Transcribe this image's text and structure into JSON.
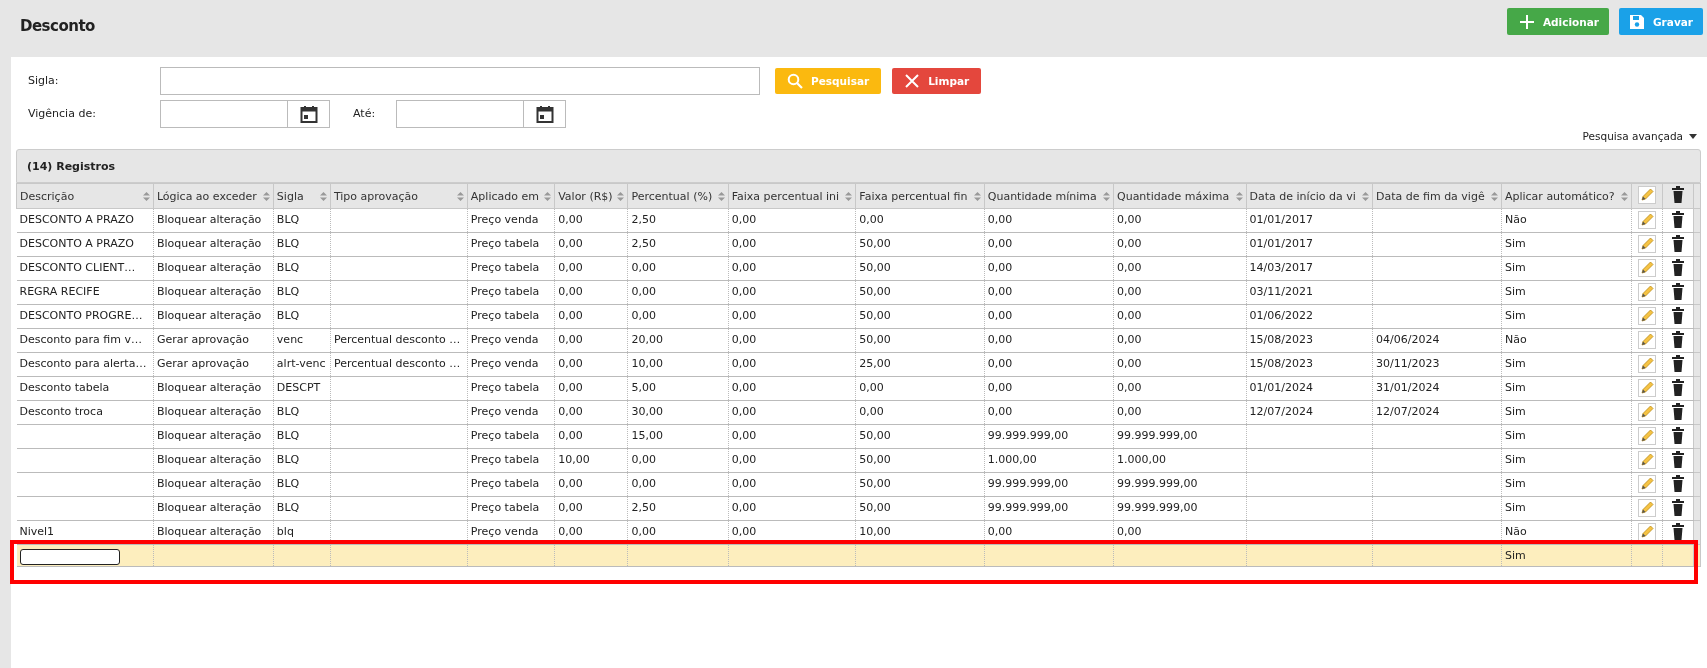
{
  "page": {
    "title": "Desconto"
  },
  "header_buttons": [
    {
      "label": "Adicionar",
      "kind": "add"
    },
    {
      "label": "Gravar",
      "kind": "save"
    }
  ],
  "filters": {
    "sigla_label": "Sigla:",
    "vigencia_label": "Vigência de:",
    "ate_label": "Até:",
    "search_button": "Pesquisar",
    "clear_button": "Limpar",
    "advanced_link": "Pesquisa avançada"
  },
  "panel": {
    "title": "(14) Registros"
  },
  "table": {
    "columns": [
      {
        "label": "Descrição",
        "sortable": true
      },
      {
        "label": "Lógica ao exceder",
        "sortable": true
      },
      {
        "label": "Sigla",
        "sortable": true
      },
      {
        "label": "Tipo aprovação",
        "sortable": true
      },
      {
        "label": "Aplicado em",
        "sortable": true
      },
      {
        "label": "Valor (R$)",
        "sortable": true
      },
      {
        "label": "Percentual (%)",
        "sortable": true
      },
      {
        "label": "Faixa percentual ini",
        "sortable": true
      },
      {
        "label": "Faixa percentual fin",
        "sortable": true
      },
      {
        "label": "Quantidade mínima",
        "sortable": true
      },
      {
        "label": "Quantidade máxima",
        "sortable": true
      },
      {
        "label": "Data de início da vi",
        "sortable": true
      },
      {
        "label": "Data de fim da vigê",
        "sortable": true
      },
      {
        "label": "Aplicar automático?",
        "sortable": true
      }
    ],
    "rows": [
      {
        "kind": "record",
        "cells": [
          "DESCONTO A PRAZO",
          "Bloquear alteração",
          "BLQ",
          null,
          "Preço venda",
          "0,00",
          "2,50",
          "0,00",
          "0,00",
          "0,00",
          "0,00",
          "01/01/2017",
          null,
          "Não"
        ]
      },
      {
        "kind": "record",
        "cells": [
          "DESCONTO A PRAZO",
          "Bloquear alteração",
          "BLQ",
          null,
          "Preço tabela",
          "0,00",
          "2,50",
          "0,00",
          "50,00",
          "0,00",
          "0,00",
          "01/01/2017",
          null,
          "Sim"
        ]
      },
      {
        "kind": "record",
        "cells": [
          "DESCONTO CLIENT…",
          "Bloquear alteração",
          "BLQ",
          null,
          "Preço tabela",
          "0,00",
          "0,00",
          "0,00",
          "50,00",
          "0,00",
          "0,00",
          "14/03/2017",
          null,
          "Sim"
        ]
      },
      {
        "kind": "record",
        "cells": [
          "REGRA RECIFE",
          "Bloquear alteração",
          "BLQ",
          null,
          "Preço tabela",
          "0,00",
          "0,00",
          "0,00",
          "50,00",
          "0,00",
          "0,00",
          "03/11/2021",
          null,
          "Sim"
        ]
      },
      {
        "kind": "record",
        "cells": [
          "DESCONTO PROGRE…",
          "Bloquear alteração",
          "BLQ",
          null,
          "Preço tabela",
          "0,00",
          "0,00",
          "0,00",
          "50,00",
          "0,00",
          "0,00",
          "01/06/2022",
          null,
          "Sim"
        ]
      },
      {
        "kind": "record",
        "cells": [
          "Desconto para fim v…",
          "Gerar aprovação",
          "venc",
          "Percentual desconto …",
          "Preço venda",
          "0,00",
          "20,00",
          "0,00",
          "50,00",
          "0,00",
          "0,00",
          "15/08/2023",
          "04/06/2024",
          "Não"
        ]
      },
      {
        "kind": "record",
        "cells": [
          "Desconto para alerta…",
          "Gerar aprovação",
          "alrt-venc",
          "Percentual desconto …",
          "Preço venda",
          "0,00",
          "10,00",
          "0,00",
          "25,00",
          "0,00",
          "0,00",
          "15/08/2023",
          "30/11/2023",
          "Sim"
        ]
      },
      {
        "kind": "record",
        "cells": [
          "Desconto tabela",
          "Bloquear alteração",
          "DESCPT",
          null,
          "Preço tabela",
          "0,00",
          "5,00",
          "0,00",
          "0,00",
          "0,00",
          "0,00",
          "01/01/2024",
          "31/01/2024",
          "Sim"
        ]
      },
      {
        "kind": "record",
        "cells": [
          "Desconto troca",
          "Bloquear alteração",
          "BLQ",
          null,
          "Preço venda",
          "0,00",
          "30,00",
          "0,00",
          "0,00",
          "0,00",
          "0,00",
          "12/07/2024",
          "12/07/2024",
          "Sim"
        ]
      },
      {
        "kind": "record",
        "cells": [
          null,
          "Bloquear alteração",
          "BLQ",
          null,
          "Preço tabela",
          "0,00",
          "15,00",
          "0,00",
          "50,00",
          "99.999.999,00",
          "99.999.999,00",
          null,
          null,
          "Sim"
        ]
      },
      {
        "kind": "record",
        "cells": [
          null,
          "Bloquear alteração",
          "BLQ",
          null,
          "Preço tabela",
          "10,00",
          "0,00",
          "0,00",
          "50,00",
          "1.000,00",
          "1.000,00",
          null,
          null,
          "Sim"
        ]
      },
      {
        "kind": "record",
        "cells": [
          null,
          "Bloquear alteração",
          "BLQ",
          null,
          "Preço tabela",
          "0,00",
          "0,00",
          "0,00",
          "50,00",
          "99.999.999,00",
          "99.999.999,00",
          null,
          null,
          "Sim"
        ]
      },
      {
        "kind": "record",
        "cells": [
          null,
          "Bloquear alteração",
          "BLQ",
          null,
          "Preço tabela",
          "0,00",
          "2,50",
          "0,00",
          "50,00",
          "99.999.999,00",
          "99.999.999,00",
          null,
          null,
          "Sim"
        ]
      },
      {
        "kind": "record",
        "cells": [
          "Nivel1",
          "Bloquear alteração",
          "blq",
          null,
          "Preço venda",
          "0,00",
          "0,00",
          "0,00",
          "10,00",
          "0,00",
          "0,00",
          null,
          null,
          "Não"
        ]
      },
      {
        "kind": "new",
        "outlined": true,
        "cells": [
          null,
          null,
          null,
          null,
          null,
          null,
          null,
          null,
          null,
          null,
          null,
          null,
          null,
          "Sim"
        ]
      }
    ]
  }
}
